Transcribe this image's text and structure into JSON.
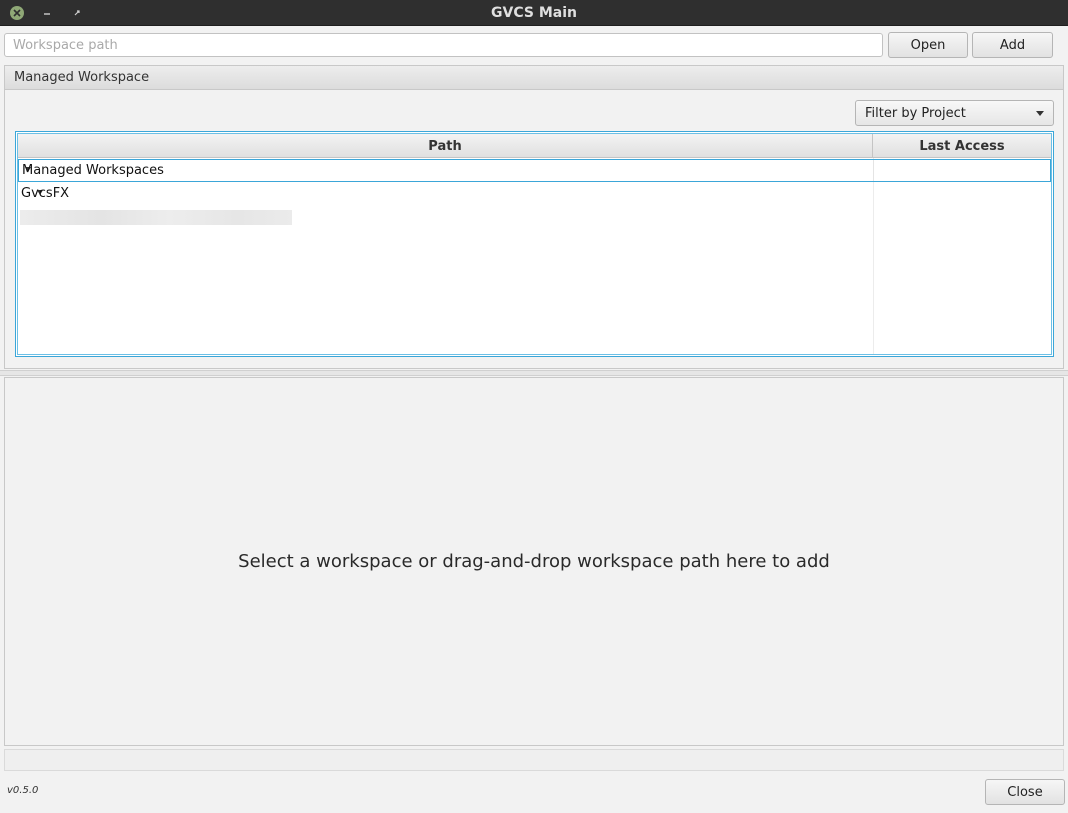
{
  "window": {
    "title": "GVCS Main"
  },
  "toolbar": {
    "path_placeholder": "Workspace path",
    "path_value": "",
    "open_label": "Open",
    "add_label": "Add"
  },
  "workspace_panel": {
    "title": "Managed Workspace",
    "filter_label": "Filter by Project",
    "columns": {
      "path": "Path",
      "last_access": "Last Access"
    },
    "rows": [
      {
        "label": "Managed Workspaces",
        "last_access": ""
      },
      {
        "label": "GvcsFX",
        "last_access": ""
      }
    ]
  },
  "drop_area": {
    "hint": "Select a workspace or drag-and-drop workspace path here to add"
  },
  "footer": {
    "version": "v0.5.0",
    "close_label": "Close"
  },
  "colors": {
    "titlebar": "#2f2f2f",
    "close_button": "#8fa876",
    "focus_border": "#3ba6d8"
  }
}
